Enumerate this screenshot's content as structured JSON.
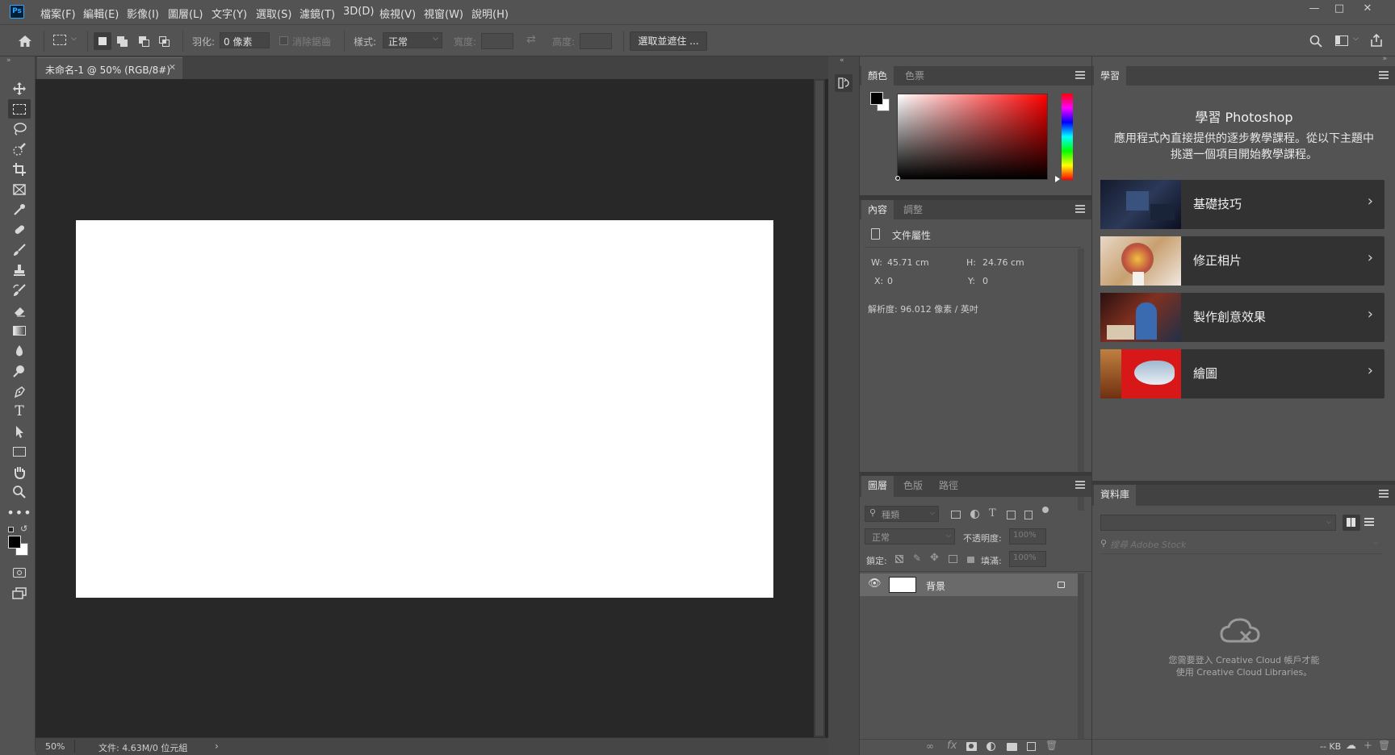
{
  "menu": [
    "檔案(F)",
    "編輯(E)",
    "影像(I)",
    "圖層(L)",
    "文字(Y)",
    "選取(S)",
    "濾鏡(T)",
    "3D(D)",
    "檢視(V)",
    "視窗(W)",
    "說明(H)"
  ],
  "app_logo": "Ps",
  "options": {
    "feather_label": "羽化:",
    "feather_value": "0 像素",
    "antialias_label": "消除鋸齒",
    "style_label": "樣式:",
    "style_value": "正常",
    "width_label": "寬度:",
    "height_label": "高度:",
    "select_mask_button": "選取並遮住 ..."
  },
  "document": {
    "tab_title": "未命名-1 @ 50% (RGB/8#)",
    "zoom": "50%",
    "file_info": "文件: 4.63M/0 位元組"
  },
  "color_panel": {
    "tabs": [
      "顏色",
      "色票"
    ]
  },
  "properties_panel": {
    "tabs": [
      "內容",
      "調整"
    ],
    "doc_props_label": "文件屬性",
    "w_label": "W:",
    "w_value": "45.71 cm",
    "h_label": "H:",
    "h_value": "24.76 cm",
    "x_label": "X:",
    "x_value": "0",
    "y_label": "Y:",
    "y_value": "0",
    "resolution": "解析度: 96.012 像素 / 英吋"
  },
  "layers_panel": {
    "tabs": [
      "圖層",
      "色版",
      "路徑"
    ],
    "filter_placeholder": "種類",
    "blend_mode": "正常",
    "opacity_label": "不透明度:",
    "opacity_value": "100%",
    "lock_label": "鎖定:",
    "fill_label": "填滿:",
    "fill_value": "100%",
    "layers": [
      {
        "name": "背景"
      }
    ]
  },
  "learn_panel": {
    "tab": "學習",
    "title": "學習 Photoshop",
    "description": "應用程式內直接提供的逐步教學課程。從以下主題中挑選一個項目開始教學課程。",
    "items": [
      {
        "label": "基礎技巧"
      },
      {
        "label": "修正相片"
      },
      {
        "label": "製作創意效果"
      },
      {
        "label": "繪圖"
      }
    ]
  },
  "library_panel": {
    "tab": "資料庫",
    "search_placeholder": "搜尋 Adobe Stock",
    "message_line1": "您需要登入 Creative Cloud 帳戶才能",
    "message_line2": "使用 Creative Cloud Libraries。",
    "footer_kb": "-- KB"
  },
  "colors": {
    "ui_bg": "#535353",
    "doc_bg": "#282828",
    "canvas": "#ffffff",
    "ps_blue": "#31a8ff",
    "card_bg": "#323232"
  }
}
